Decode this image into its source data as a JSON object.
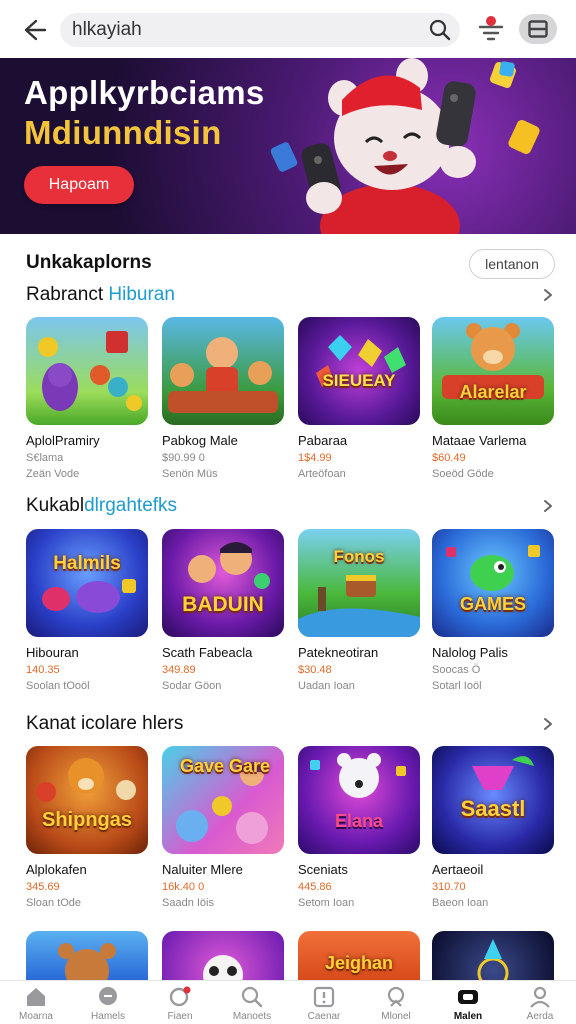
{
  "search": {
    "value": "hlkayiah"
  },
  "banner": {
    "title_line1": "Applkyrbciams",
    "title_line2": "Mdiunndisin",
    "button_label": "Hapoam"
  },
  "header": {
    "title": "Unkakaplorns",
    "tag_button": "lentanon"
  },
  "sections": [
    {
      "title_prefix": "Rabranct",
      "title_accent": "Hiburan",
      "apps": [
        {
          "name": "AplolPramiry",
          "price": "S€lama",
          "meta": "Zeän Vode"
        },
        {
          "name": "Pabkog Male",
          "price": "$90.99 0",
          "meta": "Senön Müs"
        },
        {
          "name": "Pabaraa",
          "price": "1$4.99",
          "meta": "Arteöfoan"
        },
        {
          "name": "Mataae Varlema",
          "price": "$60.49",
          "meta": "Soeöd Göde"
        }
      ]
    },
    {
      "title_prefix": "Kukabl",
      "title_accent": "dlrgahtefks",
      "apps": [
        {
          "name": "Hibouran",
          "price": "140.35",
          "meta": "Soolan tOoöl"
        },
        {
          "name": "Scath Fabeacla",
          "price": "349.89",
          "meta": "Sodar Göon"
        },
        {
          "name": "Patekneotiran",
          "price": "$30.48",
          "meta": "Uadan Ioan"
        },
        {
          "name": "Nalolog Palis",
          "price": "Soocas Ö",
          "meta": "Sotarl Ioöl"
        }
      ]
    },
    {
      "title_prefix": "Kanat",
      "title_accent": "icolare hlers",
      "apps": [
        {
          "name": "Alplokafen",
          "price": "345.69",
          "meta": "Sloan tOde"
        },
        {
          "name": "Naluiter Mlere",
          "price": "16k.40 0",
          "meta": "Saadn Iöis"
        },
        {
          "name": "Sceniats",
          "price": "445.86",
          "meta": "Setom Ioan"
        },
        {
          "name": "Aertaeoil",
          "price": "310.70",
          "meta": "Baeon Ioan"
        }
      ]
    }
  ],
  "thumb_labels": [
    "SIEUEAY",
    "Alarelar",
    "Halmils",
    "BADUIN",
    "Fonos",
    "GAMES",
    "Shipngas",
    "Gave Gare",
    "Elana",
    "Saastl",
    "Jeighan"
  ],
  "bottom_nav": [
    {
      "label": "Moarna",
      "icon": "home-icon"
    },
    {
      "label": "Hamels",
      "icon": "chat-bubble-icon"
    },
    {
      "label": "Fiaen",
      "icon": "notification-chat-icon"
    },
    {
      "label": "Manoets",
      "icon": "search-icon"
    },
    {
      "label": "Caenar",
      "icon": "info-icon"
    },
    {
      "label": "Mlonel",
      "icon": "profile-badge-icon"
    },
    {
      "label": "Malen",
      "icon": "gamepad-icon"
    },
    {
      "label": "Aerda",
      "icon": "person-icon"
    }
  ]
}
